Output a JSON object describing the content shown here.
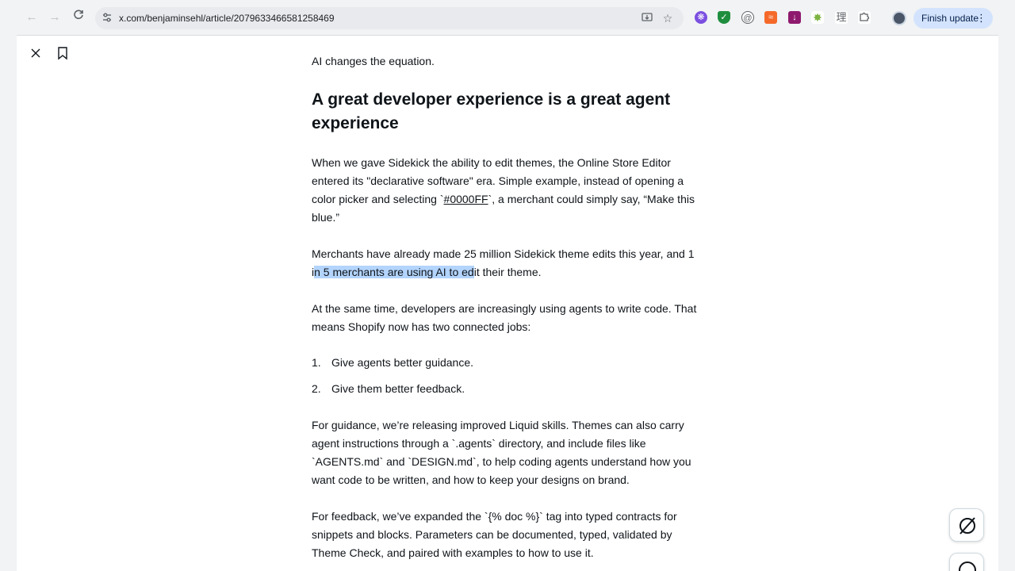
{
  "browser": {
    "url": "x.com/benjaminsehl/article/2079633466581258469",
    "update_label": "Finish update"
  },
  "article": {
    "intro": "AI changes the equation.",
    "heading": "A great developer experience is a great agent experience",
    "p1_a": "When we gave Sidekick the ability to edit themes, the Online Store Editor entered its \"declarative software\" era. Simple example, instead of opening a color picker and selecting `",
    "p1_code": "#0000FF",
    "p1_b": "`, a merchant could simply say, “Make this blue.”",
    "p2_a": "Merchants have already made 25 million Sidekick theme edits this year, and 1 i",
    "p2_hl": "n 5 merchants are using AI to ed",
    "p2_b": "it their theme.",
    "p3": "At the same time, developers are increasingly using agents to write code. That means Shopify now has two connected jobs:",
    "list": [
      {
        "num": "1.",
        "text": "Give agents better guidance."
      },
      {
        "num": "2.",
        "text": "Give them better feedback."
      }
    ],
    "p4": "For guidance, we’re releasing improved Liquid skills. Themes can also carry agent instructions through a `.agents` directory, and include files like `AGENTS.md` and `DESIGN.md`, to help coding agents understand how you want code to be written, and how to keep your designs on brand.",
    "p5": "For feedback, we’ve expanded the `{% doc %}` tag into typed contracts for snippets and blocks. Parameters can be documented, typed, validated by Theme Check, and paired with examples to how to use it."
  },
  "colors": {
    "highlight": "#b3d4fc",
    "text": "#0f1419",
    "update_chip": "#d3e3fd"
  }
}
